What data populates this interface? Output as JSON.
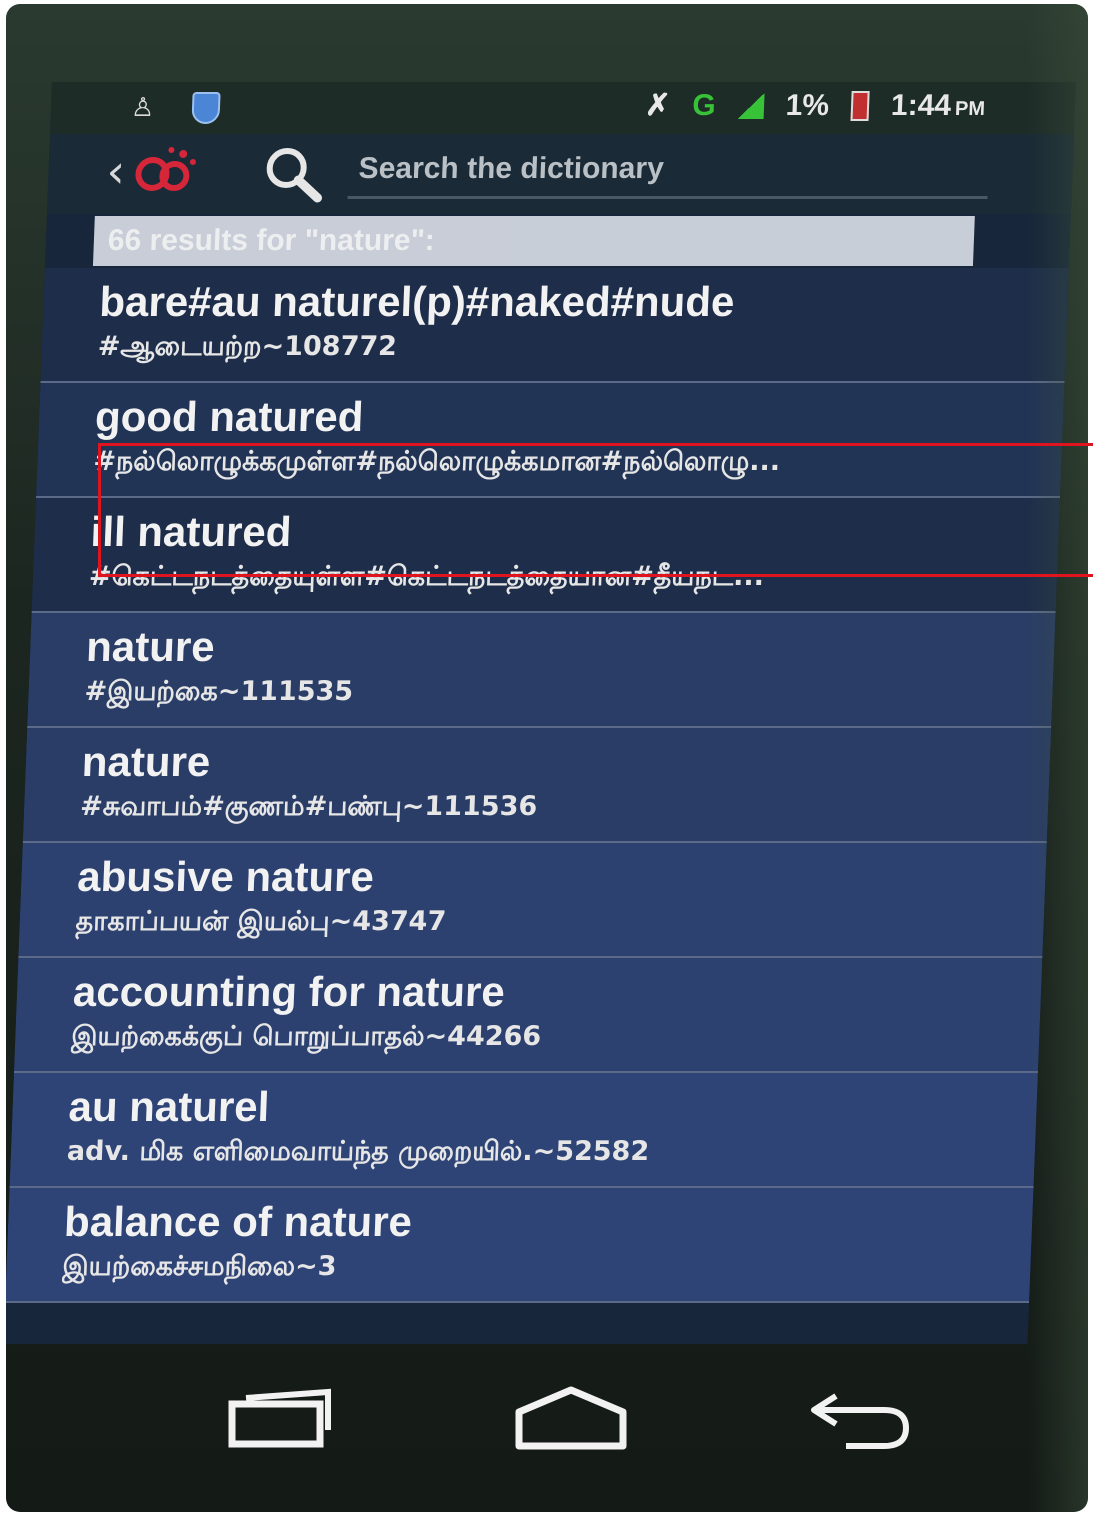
{
  "status_bar": {
    "net_type": "G",
    "battery": "1%",
    "time": "1:44",
    "ampm": "PM"
  },
  "search": {
    "placeholder": "Search the dictionary"
  },
  "results_header": "66 results for \"nature\":",
  "results": [
    {
      "term": "bare#au naturel(p)#naked#nude",
      "translation": "#ஆடையற்ற~108772"
    },
    {
      "term": "good natured",
      "translation": "#நல்லொழுக்கமுள்ள#நல்லொழுக்கமான#நல்லொழு..."
    },
    {
      "term": "ill natured",
      "translation": "#கெட்டநடத்தையுள்ள#கெட்டநடத்தையான#தீயநட..."
    },
    {
      "term": "nature",
      "translation": "#இயற்கை~111535"
    },
    {
      "term": "nature",
      "translation": "#சுவாபம்#குணம்#பண்பு~111536"
    },
    {
      "term": "abusive nature",
      "translation": "தாகாப்பயன் இயல்பு~43747"
    },
    {
      "term": "accounting for nature",
      "translation": "இயற்கைக்குப் பொறுப்பாதல்~44266"
    },
    {
      "term": "au naturel",
      "translation": "adv. மிக எளிமைவாய்ந்த முறையில்.~52582"
    },
    {
      "term": "balance of nature",
      "translation": "இயற்கைச்சமநிலை~3"
    }
  ],
  "colors": {
    "highlight": "#e0141e",
    "net_type": "#37c237",
    "battery": "#c03030"
  },
  "icons": [
    "usb-icon",
    "shield-icon",
    "mute-icon",
    "signal-icon",
    "battery-icon",
    "back-icon",
    "app-logo-icon",
    "search-icon",
    "recents-icon",
    "home-icon",
    "back-nav-icon"
  ]
}
